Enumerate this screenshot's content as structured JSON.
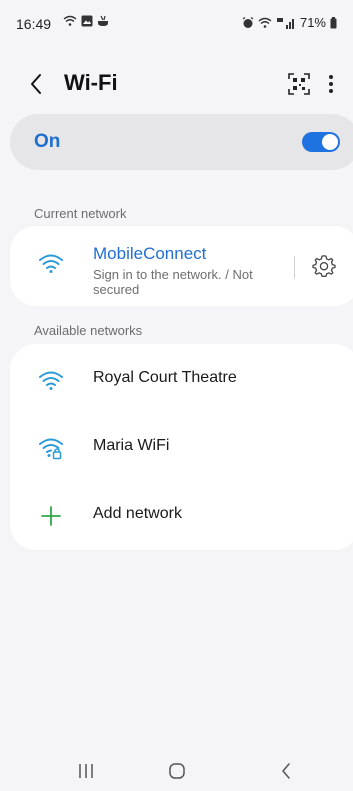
{
  "status_bar": {
    "time": "16:49",
    "battery": "71%",
    "left_icons": [
      "wifi-calling-icon",
      "gallery-icon",
      "notification-icon"
    ],
    "right_icons": [
      "alarm-icon",
      "wifi-icon",
      "signal-icon",
      "battery-icon"
    ]
  },
  "header": {
    "title": "Wi-Fi",
    "back_icon": "chevron-left-icon",
    "qr_icon": "qr-scan-icon",
    "more_icon": "more-vertical-icon"
  },
  "wifi_toggle": {
    "label": "On",
    "state": "on",
    "accent": "#1f73e0"
  },
  "current_network": {
    "section_label": "Current network",
    "name": "MobileConnect",
    "status": "Sign in to the network. / Not secured",
    "icon": "wifi-icon",
    "settings_icon": "gear-icon"
  },
  "available_networks": {
    "section_label": "Available networks",
    "items": [
      {
        "name": "Royal Court Theatre",
        "icon": "wifi-icon",
        "secured": false
      },
      {
        "name": "Maria WiFi",
        "icon": "wifi-lock-icon",
        "secured": true
      },
      {
        "name": "Add network",
        "icon": "plus-icon",
        "secured": false
      }
    ]
  },
  "nav_bar": {
    "buttons": [
      "recent-apps-icon",
      "home-icon",
      "back-icon"
    ]
  },
  "colors": {
    "background": "#f5f4f6",
    "card": "#ffffff",
    "accent_text": "#1f6fd1",
    "wifi_icon": "#2b9bd6",
    "add_icon": "#2ea84a"
  }
}
